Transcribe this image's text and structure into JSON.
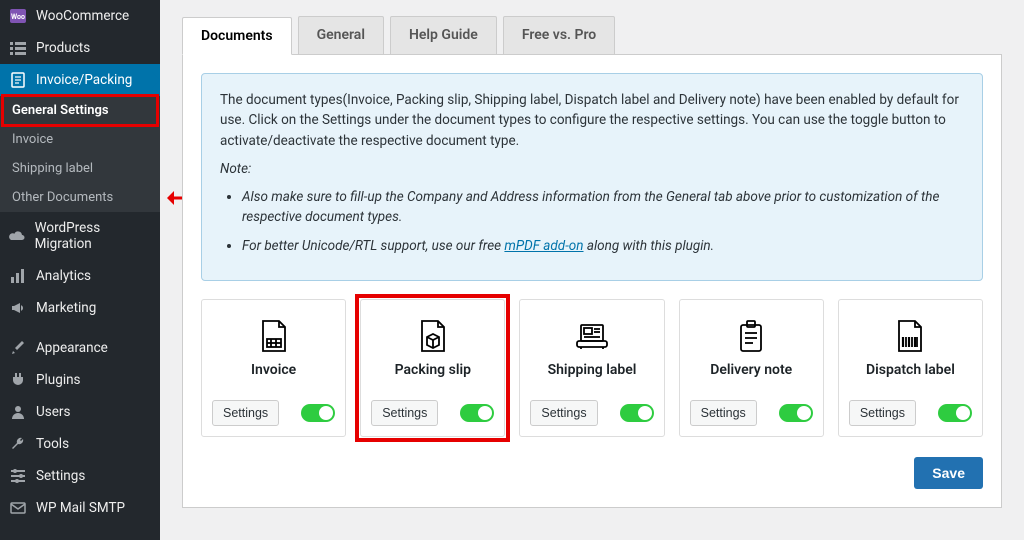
{
  "sidebar": {
    "items": [
      {
        "label": "WooCommerce",
        "icon": "woo-icon"
      },
      {
        "label": "Products",
        "icon": "list-icon"
      },
      {
        "label": "Invoice/Packing",
        "icon": "invoice-icon",
        "active": true
      },
      {
        "label": "WordPress Migration",
        "icon": "cloud-icon"
      },
      {
        "label": "Analytics",
        "icon": "bar-chart-icon"
      },
      {
        "label": "Marketing",
        "icon": "megaphone-icon"
      },
      {
        "label": "Appearance",
        "icon": "brush-icon"
      },
      {
        "label": "Plugins",
        "icon": "plugin-icon"
      },
      {
        "label": "Users",
        "icon": "user-icon"
      },
      {
        "label": "Tools",
        "icon": "wrench-icon"
      },
      {
        "label": "Settings",
        "icon": "sliders-icon"
      },
      {
        "label": "WP Mail SMTP",
        "icon": "mail-icon"
      }
    ],
    "sub": {
      "general_settings": "General Settings",
      "invoice": "Invoice",
      "shipping_label": "Shipping label",
      "other_documents": "Other Documents"
    }
  },
  "tabs": {
    "documents": "Documents",
    "general": "General",
    "help_guide": "Help Guide",
    "free_vs_pro": "Free vs. Pro"
  },
  "notice": {
    "main": "The document types(Invoice, Packing slip, Shipping label, Dispatch label and Delivery note) have been enabled by default for use. Click on the Settings under the document types to configure the respective settings. You can use the toggle button to activate/deactivate the respective document type.",
    "note_label": "Note:",
    "bullet1": "Also make sure to fill-up the Company and Address information from the General tab above prior to customization of the respective document types.",
    "bullet2_pre": "For better Unicode/RTL support, use our free ",
    "bullet2_link": "mPDF add-on",
    "bullet2_post": " along with this plugin."
  },
  "cards": [
    {
      "title": "Invoice",
      "settings": "Settings"
    },
    {
      "title": "Packing slip",
      "settings": "Settings",
      "highlight": true
    },
    {
      "title": "Shipping label",
      "settings": "Settings"
    },
    {
      "title": "Delivery note",
      "settings": "Settings"
    },
    {
      "title": "Dispatch label",
      "settings": "Settings"
    }
  ],
  "buttons": {
    "save": "Save"
  }
}
